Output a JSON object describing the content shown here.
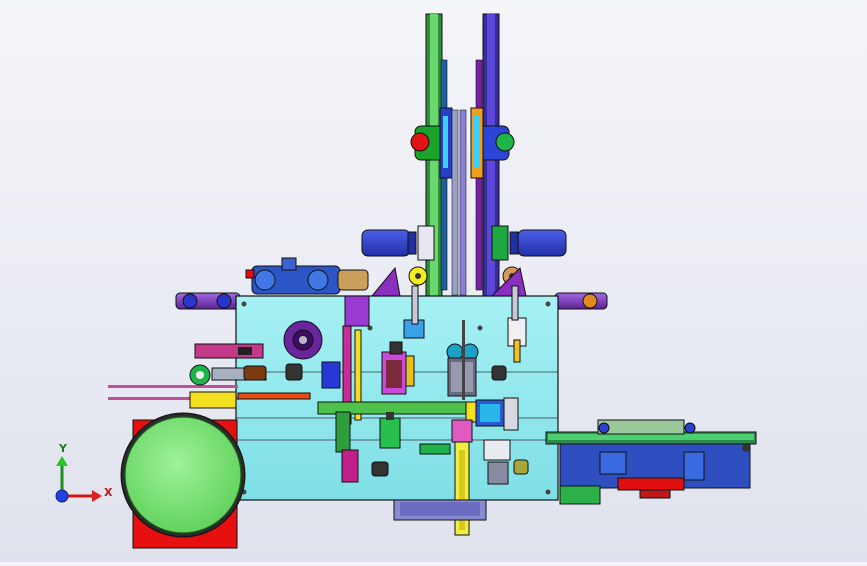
{
  "viewport": {
    "background": "#eceef5",
    "colors": {
      "plate": "#8fe8ee",
      "green": "#3fd45a",
      "red": "#e01010",
      "purple": "#7a1fa8",
      "blue": "#2b3fcf",
      "yellow": "#f2ee20",
      "gray": "#b9b9c4",
      "darkblue": "#223d8a"
    }
  },
  "triad": {
    "x_label": "X",
    "y_label": "Y",
    "x_color": "#d11818",
    "y_color": "#1f8f1f",
    "z_color": "#2040e0"
  }
}
